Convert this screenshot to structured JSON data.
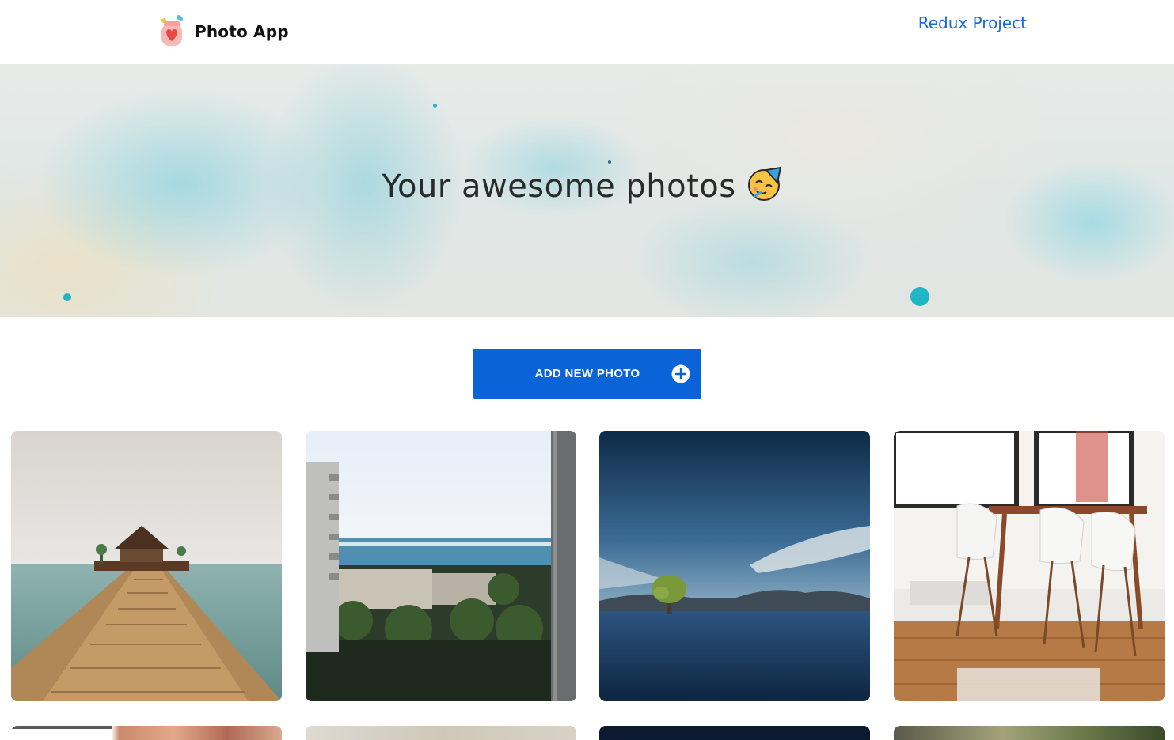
{
  "header": {
    "brand_name": "Photo App",
    "brand_icon": "heart-jar-icon",
    "nav_link": "Redux Project",
    "nav_link_color": "#1769d9"
  },
  "banner": {
    "title": "Your awesome photos",
    "emoji_icon": "partying-face-icon"
  },
  "actions": {
    "add_photo_label": "ADD NEW PHOTO",
    "add_photo_icon": "plus-circle-icon",
    "accent_color": "#0a64d8"
  },
  "gallery": {
    "photos": [
      {
        "subject": "wooden-pier-icon"
      },
      {
        "subject": "city-sea-view-icon"
      },
      {
        "subject": "lake-tree-icon"
      },
      {
        "subject": "dining-room-icon"
      },
      {
        "subject": "photo-icon"
      },
      {
        "subject": "photo-icon"
      },
      {
        "subject": "photo-icon"
      },
      {
        "subject": "photo-icon"
      }
    ]
  }
}
